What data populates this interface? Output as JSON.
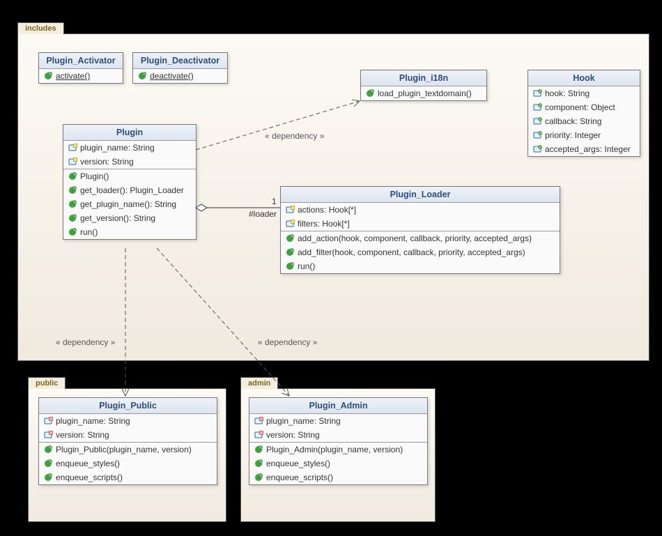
{
  "packages": {
    "includes": {
      "label": "includes"
    },
    "public": {
      "label": "public"
    },
    "admin": {
      "label": "admin"
    }
  },
  "classes": {
    "activator": {
      "title": "Plugin_Activator",
      "methods": [
        "activate()"
      ]
    },
    "deactivator": {
      "title": "Plugin_Deactivator",
      "methods": [
        "deactivate()"
      ]
    },
    "i18n": {
      "title": "Plugin_i18n",
      "methods": [
        "load_plugin_textdomain()"
      ]
    },
    "hook": {
      "title": "Hook",
      "attrs": [
        "hook: String",
        "component: Object",
        "callback: String",
        "priority: Integer",
        "accepted_args: Integer"
      ]
    },
    "plugin": {
      "title": "Plugin",
      "attrs": [
        "plugin_name: String",
        "version: String"
      ],
      "methods": [
        "Plugin()",
        "get_loader(): Plugin_Loader",
        "get_plugin_name(): String",
        "get_version(): String",
        "run()"
      ]
    },
    "loader": {
      "title": "Plugin_Loader",
      "attrs": [
        "actions: Hook[*]",
        "filters: Hook[*]"
      ],
      "methods": [
        "add_action(hook, component, callback, priority, accepted_args)",
        "add_filter(hook, component, callback, priority, accepted_args)",
        "run()"
      ]
    },
    "publicCls": {
      "title": "Plugin_Public",
      "attrs": [
        "plugin_name: String",
        "version: String"
      ],
      "methods": [
        "Plugin_Public(plugin_name, version)",
        "enqueue_styles()",
        "enqueue_scripts()"
      ]
    },
    "adminCls": {
      "title": "Plugin_Admin",
      "attrs": [
        "plugin_name: String",
        "version: String"
      ],
      "methods": [
        "Plugin_Admin(plugin_name, version)",
        "enqueue_styles()",
        "enqueue_scripts()"
      ]
    }
  },
  "labels": {
    "dependency": "« dependency »",
    "assoc_end_mult": "1",
    "assoc_end_role": "#loader"
  }
}
